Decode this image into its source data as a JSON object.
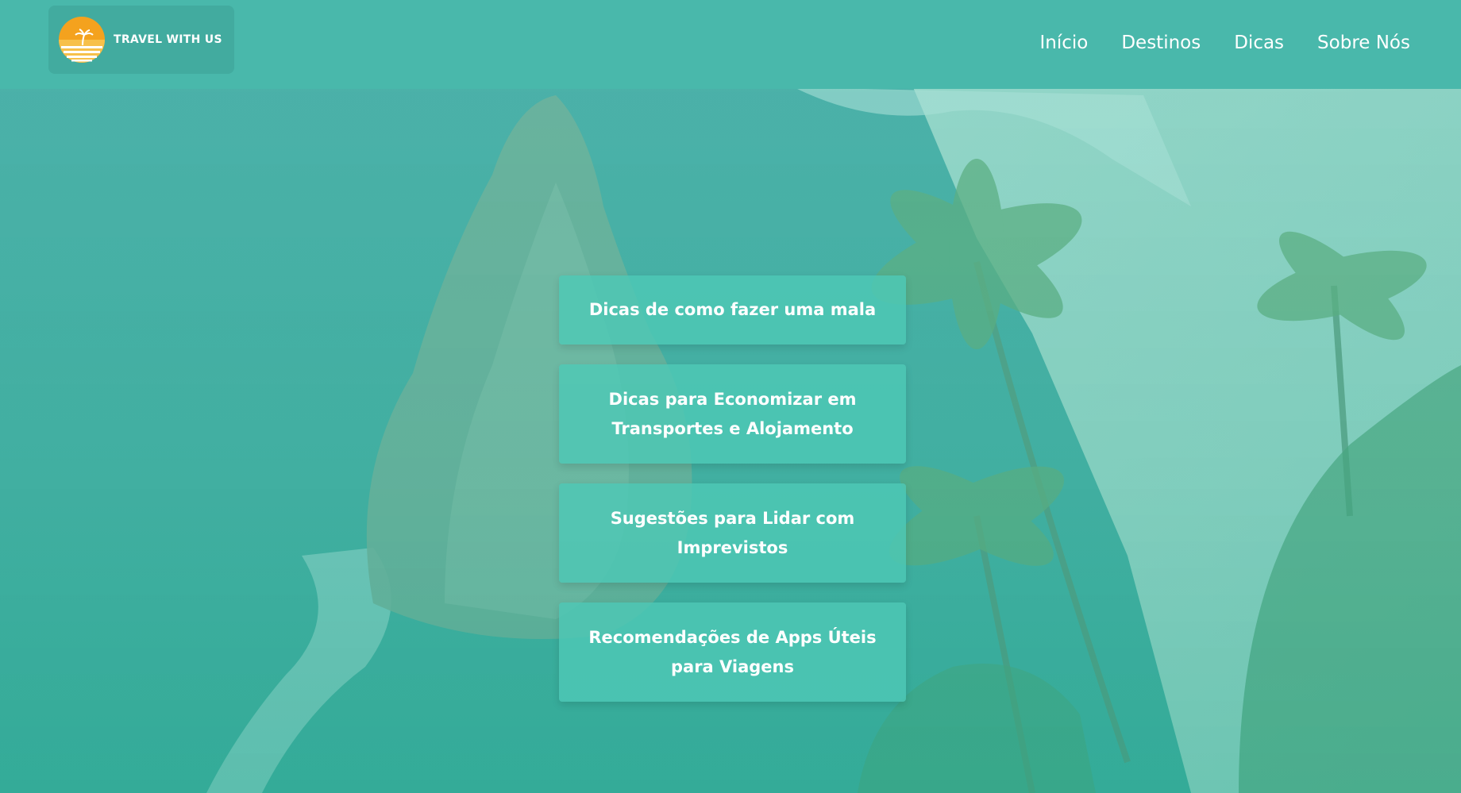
{
  "colors": {
    "header_bg": "#49b8ab",
    "tile_bg": "#4ec8b6",
    "text": "#ffffff",
    "logo_sun": "#f4a21e"
  },
  "logo": {
    "text": "TRAVEL WITH US",
    "icon": "sunset-palm-icon"
  },
  "nav": {
    "items": [
      {
        "label": "Início"
      },
      {
        "label": "Destinos"
      },
      {
        "label": "Dicas"
      },
      {
        "label": "Sobre Nós"
      }
    ]
  },
  "tips": [
    {
      "label": "Dicas de como fazer uma mala"
    },
    {
      "label": "Dicas para Economizar em Transportes e Alojamento"
    },
    {
      "label": "Sugestões para Lidar com Imprevistos"
    },
    {
      "label": "Recomendações de Apps Úteis para Viagens"
    }
  ]
}
